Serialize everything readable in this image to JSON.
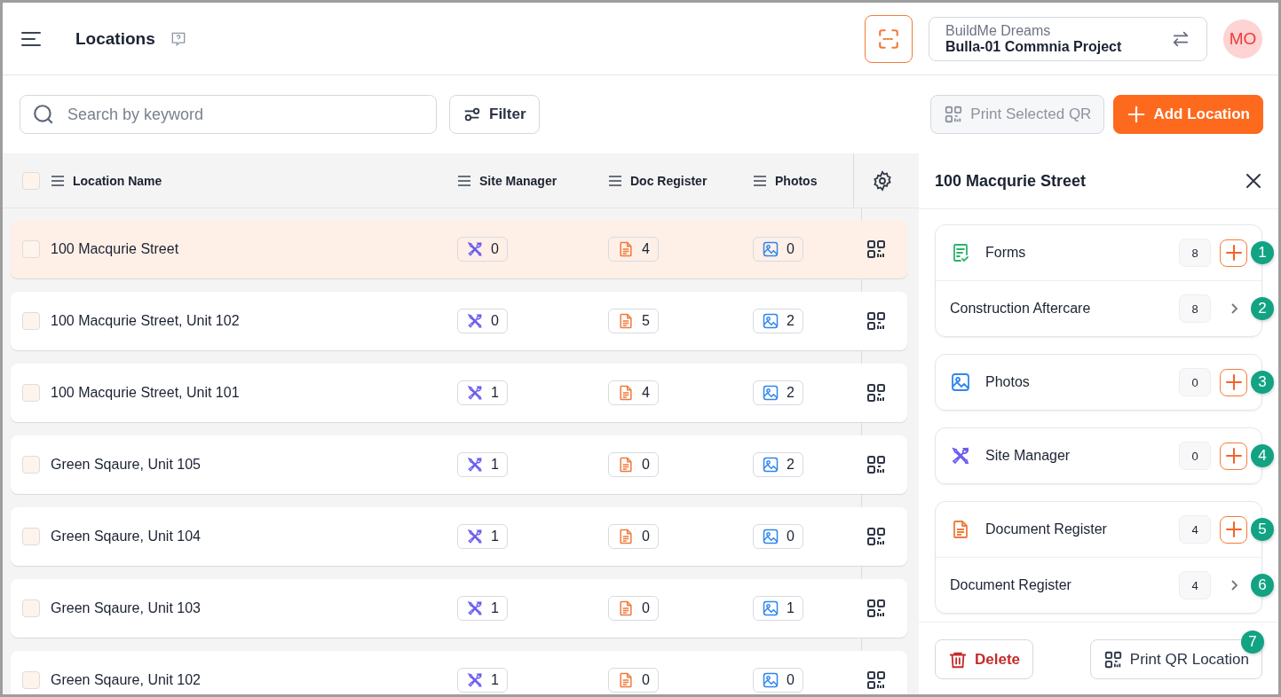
{
  "header": {
    "title": "Locations"
  },
  "project": {
    "company": "BuildMe Dreams",
    "name": "Bulla-01 Commnia Project"
  },
  "avatar": {
    "initials": "MO"
  },
  "search": {
    "placeholder": "Search by keyword"
  },
  "filter_button": {
    "label": "Filter"
  },
  "print_selected_button": {
    "label": "Print Selected QR",
    "disabled": true
  },
  "add_button": {
    "label": "Add Location"
  },
  "table": {
    "select_all_checked": false,
    "columns": [
      "Location Name",
      "Site Manager",
      "Doc Register",
      "Photos"
    ],
    "rows": [
      {
        "name": "100 Macqurie Street",
        "site_manager": "0",
        "doc_register": "4",
        "photos": "0",
        "selected": true,
        "checked": false
      },
      {
        "name": "100 Macqurie Street, Unit 102",
        "site_manager": "0",
        "doc_register": "5",
        "photos": "2",
        "selected": false,
        "checked": false
      },
      {
        "name": "100 Macqurie Street, Unit 101",
        "site_manager": "1",
        "doc_register": "4",
        "photos": "2",
        "selected": false,
        "checked": false
      },
      {
        "name": "Green Sqaure, Unit 105",
        "site_manager": "1",
        "doc_register": "0",
        "photos": "2",
        "selected": false,
        "checked": false
      },
      {
        "name": "Green Sqaure, Unit 104",
        "site_manager": "1",
        "doc_register": "0",
        "photos": "0",
        "selected": false,
        "checked": false
      },
      {
        "name": "Green Sqaure, Unit 103",
        "site_manager": "1",
        "doc_register": "0",
        "photos": "1",
        "selected": false,
        "checked": false
      },
      {
        "name": "Green Sqaure, Unit 102",
        "site_manager": "1",
        "doc_register": "0",
        "photos": "0",
        "selected": false,
        "checked": false
      }
    ]
  },
  "panel": {
    "title": "100 Macqurie Street",
    "groups": [
      {
        "kind": "forms",
        "items": [
          {
            "kind": "header",
            "label": "Forms",
            "count": "8",
            "marker": "1"
          },
          {
            "kind": "link",
            "label": "Construction Aftercare",
            "count": "8",
            "marker": "2"
          }
        ]
      },
      {
        "kind": "photos",
        "items": [
          {
            "kind": "header",
            "label": "Photos",
            "count": "0",
            "marker": "3"
          }
        ]
      },
      {
        "kind": "site",
        "items": [
          {
            "kind": "header",
            "label": "Site Manager",
            "count": "0",
            "marker": "4"
          }
        ]
      },
      {
        "kind": "docs",
        "items": [
          {
            "kind": "header",
            "label": "Document Register",
            "count": "4",
            "marker": "5"
          },
          {
            "kind": "link",
            "label": "Document Register",
            "count": "4",
            "marker": "6"
          }
        ]
      }
    ],
    "delete_button": {
      "label": "Delete"
    },
    "print_button": {
      "label": "Print QR Location",
      "marker": "7"
    }
  }
}
